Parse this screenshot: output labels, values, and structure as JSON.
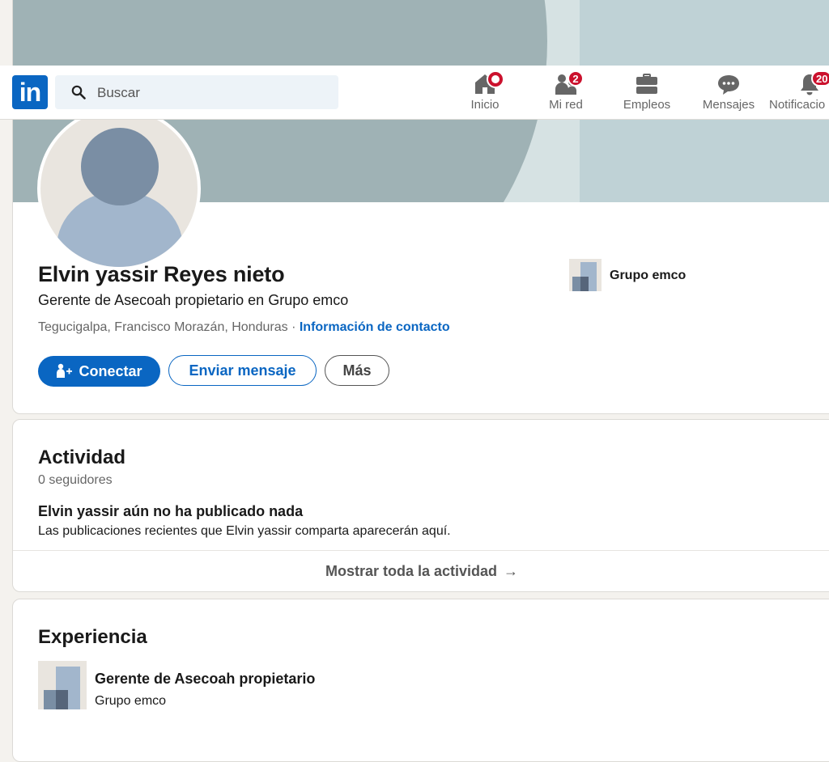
{
  "nav": {
    "logo_text": "in",
    "search": {
      "placeholder": "Buscar",
      "value": ""
    },
    "items": [
      {
        "label": "Inicio",
        "icon": "home-icon",
        "badge": ""
      },
      {
        "label": "Mi red",
        "icon": "people-icon",
        "badge": "2"
      },
      {
        "label": "Empleos",
        "icon": "briefcase-icon",
        "badge": ""
      },
      {
        "label": "Mensajes",
        "icon": "chat-icon",
        "badge": ""
      },
      {
        "label": "Notificacio",
        "icon": "bell-icon",
        "badge": "20"
      }
    ]
  },
  "profile": {
    "name": "Elvin yassir Reyes nieto",
    "headline": "Gerente de Asecoah propietario en Grupo emco",
    "location": "Tegucigalpa, Francisco Morazán, Honduras",
    "separator": "·",
    "contact_link": "Información de contacto",
    "company": "Grupo emco",
    "buttons": {
      "connect": "Conectar",
      "message": "Enviar mensaje",
      "more": "Más"
    }
  },
  "activity": {
    "title": "Actividad",
    "followers": "0 seguidores",
    "empty_title": "Elvin yassir aún no ha publicado nada",
    "empty_desc": "Las publicaciones recientes que Elvin yassir comparta aparecerán aquí.",
    "show_all": "Mostrar toda la actividad",
    "arrow": "→"
  },
  "experience": {
    "title": "Experiencia",
    "items": [
      {
        "role": "Gerente de Asecoah propietario",
        "company": "Grupo emco"
      }
    ]
  },
  "colors": {
    "brand": "#0a66c2",
    "badge": "#cb112d",
    "cover": "#9fb2b5"
  }
}
